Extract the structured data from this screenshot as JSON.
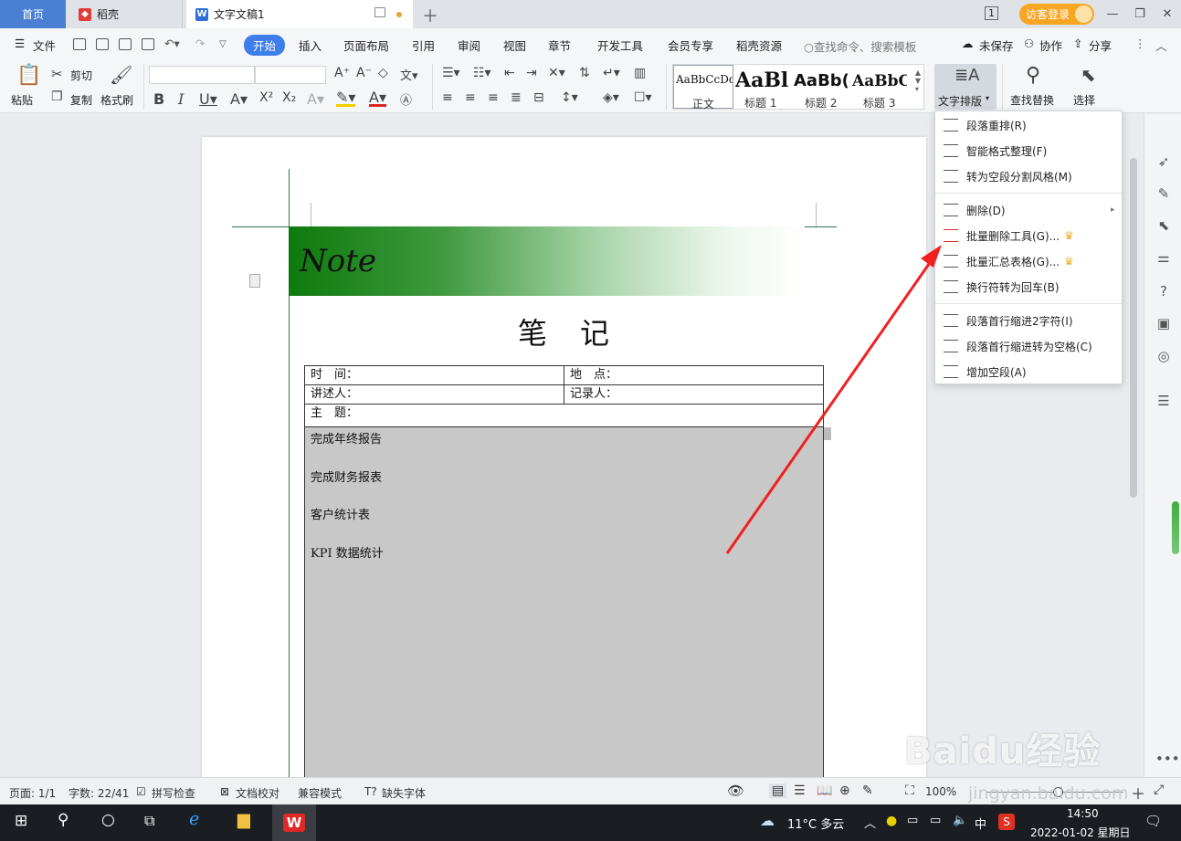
{
  "tabs": {
    "home": "首页",
    "daoke": "稻壳",
    "doc": "文字文稿1"
  },
  "login": {
    "label": "访客登录"
  },
  "menu": {
    "file": "文件",
    "items": [
      "开始",
      "插入",
      "页面布局",
      "引用",
      "审阅",
      "视图",
      "章节",
      "开发工具",
      "会员专享",
      "稻壳资源"
    ],
    "search": "查找命令、搜索模板",
    "unsaved": "未保存",
    "collab": "协作",
    "share": "分享"
  },
  "ribbon": {
    "paste": "粘贴",
    "cut": "剪切",
    "copy": "复制",
    "format_painter": "格式刷",
    "styles": [
      {
        "preview": "AaBbCcDd",
        "name": "正文"
      },
      {
        "preview": "AaBl",
        "name": "标题 1"
      },
      {
        "preview": "AaBb(",
        "name": "标题 2"
      },
      {
        "preview": "AaBbC",
        "name": "标题 3"
      }
    ],
    "text_layout": "文字排版",
    "find_replace": "查找替换",
    "select": "选择"
  },
  "dropdown": {
    "items": [
      {
        "label": "段落重排(R)",
        "crown": false
      },
      {
        "label": "智能格式整理(F)",
        "crown": false
      },
      {
        "label": "转为空段分割风格(M)",
        "crown": false
      },
      {
        "label": "删除(D)",
        "crown": false,
        "submenu": true
      },
      {
        "label": "批量删除工具(G)...",
        "crown": true
      },
      {
        "label": "批量汇总表格(G)...",
        "crown": true
      },
      {
        "label": "换行符转为回车(B)",
        "crown": false
      },
      {
        "label": "段落首行缩进2字符(I)",
        "crown": false
      },
      {
        "label": "段落首行缩进转为空格(C)",
        "crown": false
      },
      {
        "label": "增加空段(A)",
        "crown": false
      }
    ]
  },
  "document": {
    "banner": "Note",
    "title": "笔　记",
    "table": {
      "time": "时　间：",
      "place": "地　点：",
      "speaker": "讲述人：",
      "recorder": "记录人：",
      "topic": "主　题："
    },
    "tasks": [
      "完成年终报告",
      "完成财务报表",
      "客户统计表",
      "KPI 数据统计"
    ]
  },
  "status": {
    "page": "页面: 1/1",
    "words": "字数: 22/41",
    "spell": "拼写检查",
    "proof": "文档校对",
    "compat": "兼容模式",
    "missing_font": "缺失字体",
    "zoom": "100%"
  },
  "taskbar": {
    "weather": "11°C  多云",
    "ime": "中",
    "time": "14:50",
    "date": "2022-01-02 星期日"
  },
  "watermark": {
    "logo": "Baidu经验",
    "url": "jingyan.baidu.com"
  }
}
